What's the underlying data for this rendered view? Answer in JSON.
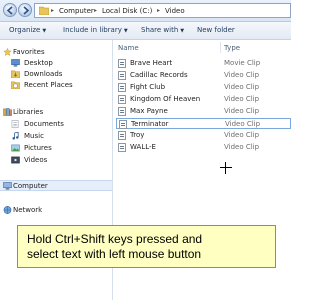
{
  "address_bar": {
    "breadcrumbs": [
      "Computer",
      "Local Disk (C:)",
      "Video"
    ]
  },
  "toolbar": {
    "organize": "Organize",
    "include_in_library": "Include in library",
    "share_with": "Share with",
    "new_folder": "New folder"
  },
  "nav_pane": {
    "favorites": "Favorites",
    "desktop": "Desktop",
    "downloads": "Downloads",
    "recent_places": "Recent Places",
    "libraries": "Libraries",
    "documents": "Documents",
    "music": "Music",
    "pictures": "Pictures",
    "videos": "Videos",
    "computer": "Computer",
    "network": "Network"
  },
  "file_list": {
    "columns": {
      "name": "Name",
      "type": "Type"
    },
    "rows": [
      {
        "name": "Brave Heart",
        "type": "Movie Clip"
      },
      {
        "name": "Cadillac Records",
        "type": "Video Clip"
      },
      {
        "name": "Fight Club",
        "type": "Video Clip"
      },
      {
        "name": "Kingdom Of Heaven",
        "type": "Video Clip"
      },
      {
        "name": "Max Payne",
        "type": "Video Clip"
      },
      {
        "name": "Terminator",
        "type": "Video Clip"
      },
      {
        "name": "Troy",
        "type": "Video Clip"
      },
      {
        "name": "WALL-E",
        "type": "Video Clip"
      }
    ]
  },
  "hint": {
    "line1": "Hold Ctrl+Shift keys pressed and",
    "line2": "select text with left mouse button"
  },
  "colors": {
    "hint_background": "#ffffc2",
    "toolbar_text": "#1e395b",
    "selection_border": "#7aa8dc"
  }
}
